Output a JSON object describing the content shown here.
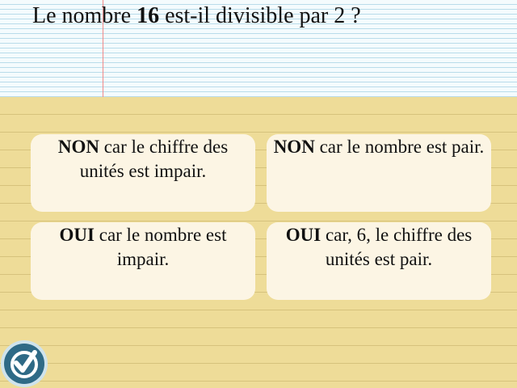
{
  "question": {
    "prefix": "Le nombre ",
    "number": "16",
    "suffix": " est-il divisible par 2 ?"
  },
  "answers": [
    {
      "lead": "NON",
      "text": " car le chiffre des unités est impair."
    },
    {
      "lead": "NON",
      "text": " car le nombre est pair."
    },
    {
      "lead": "OUI",
      "text": " car le nombre est impair."
    },
    {
      "lead": "OUI",
      "text": " car, 6, le chiffre des unités est pair."
    }
  ],
  "validate_button": {
    "icon": "checkmark-icon"
  },
  "colors": {
    "answer_card": "#fcf5e4",
    "pad_yellow": "#eedc98",
    "button_blue": "#2f6a86"
  }
}
